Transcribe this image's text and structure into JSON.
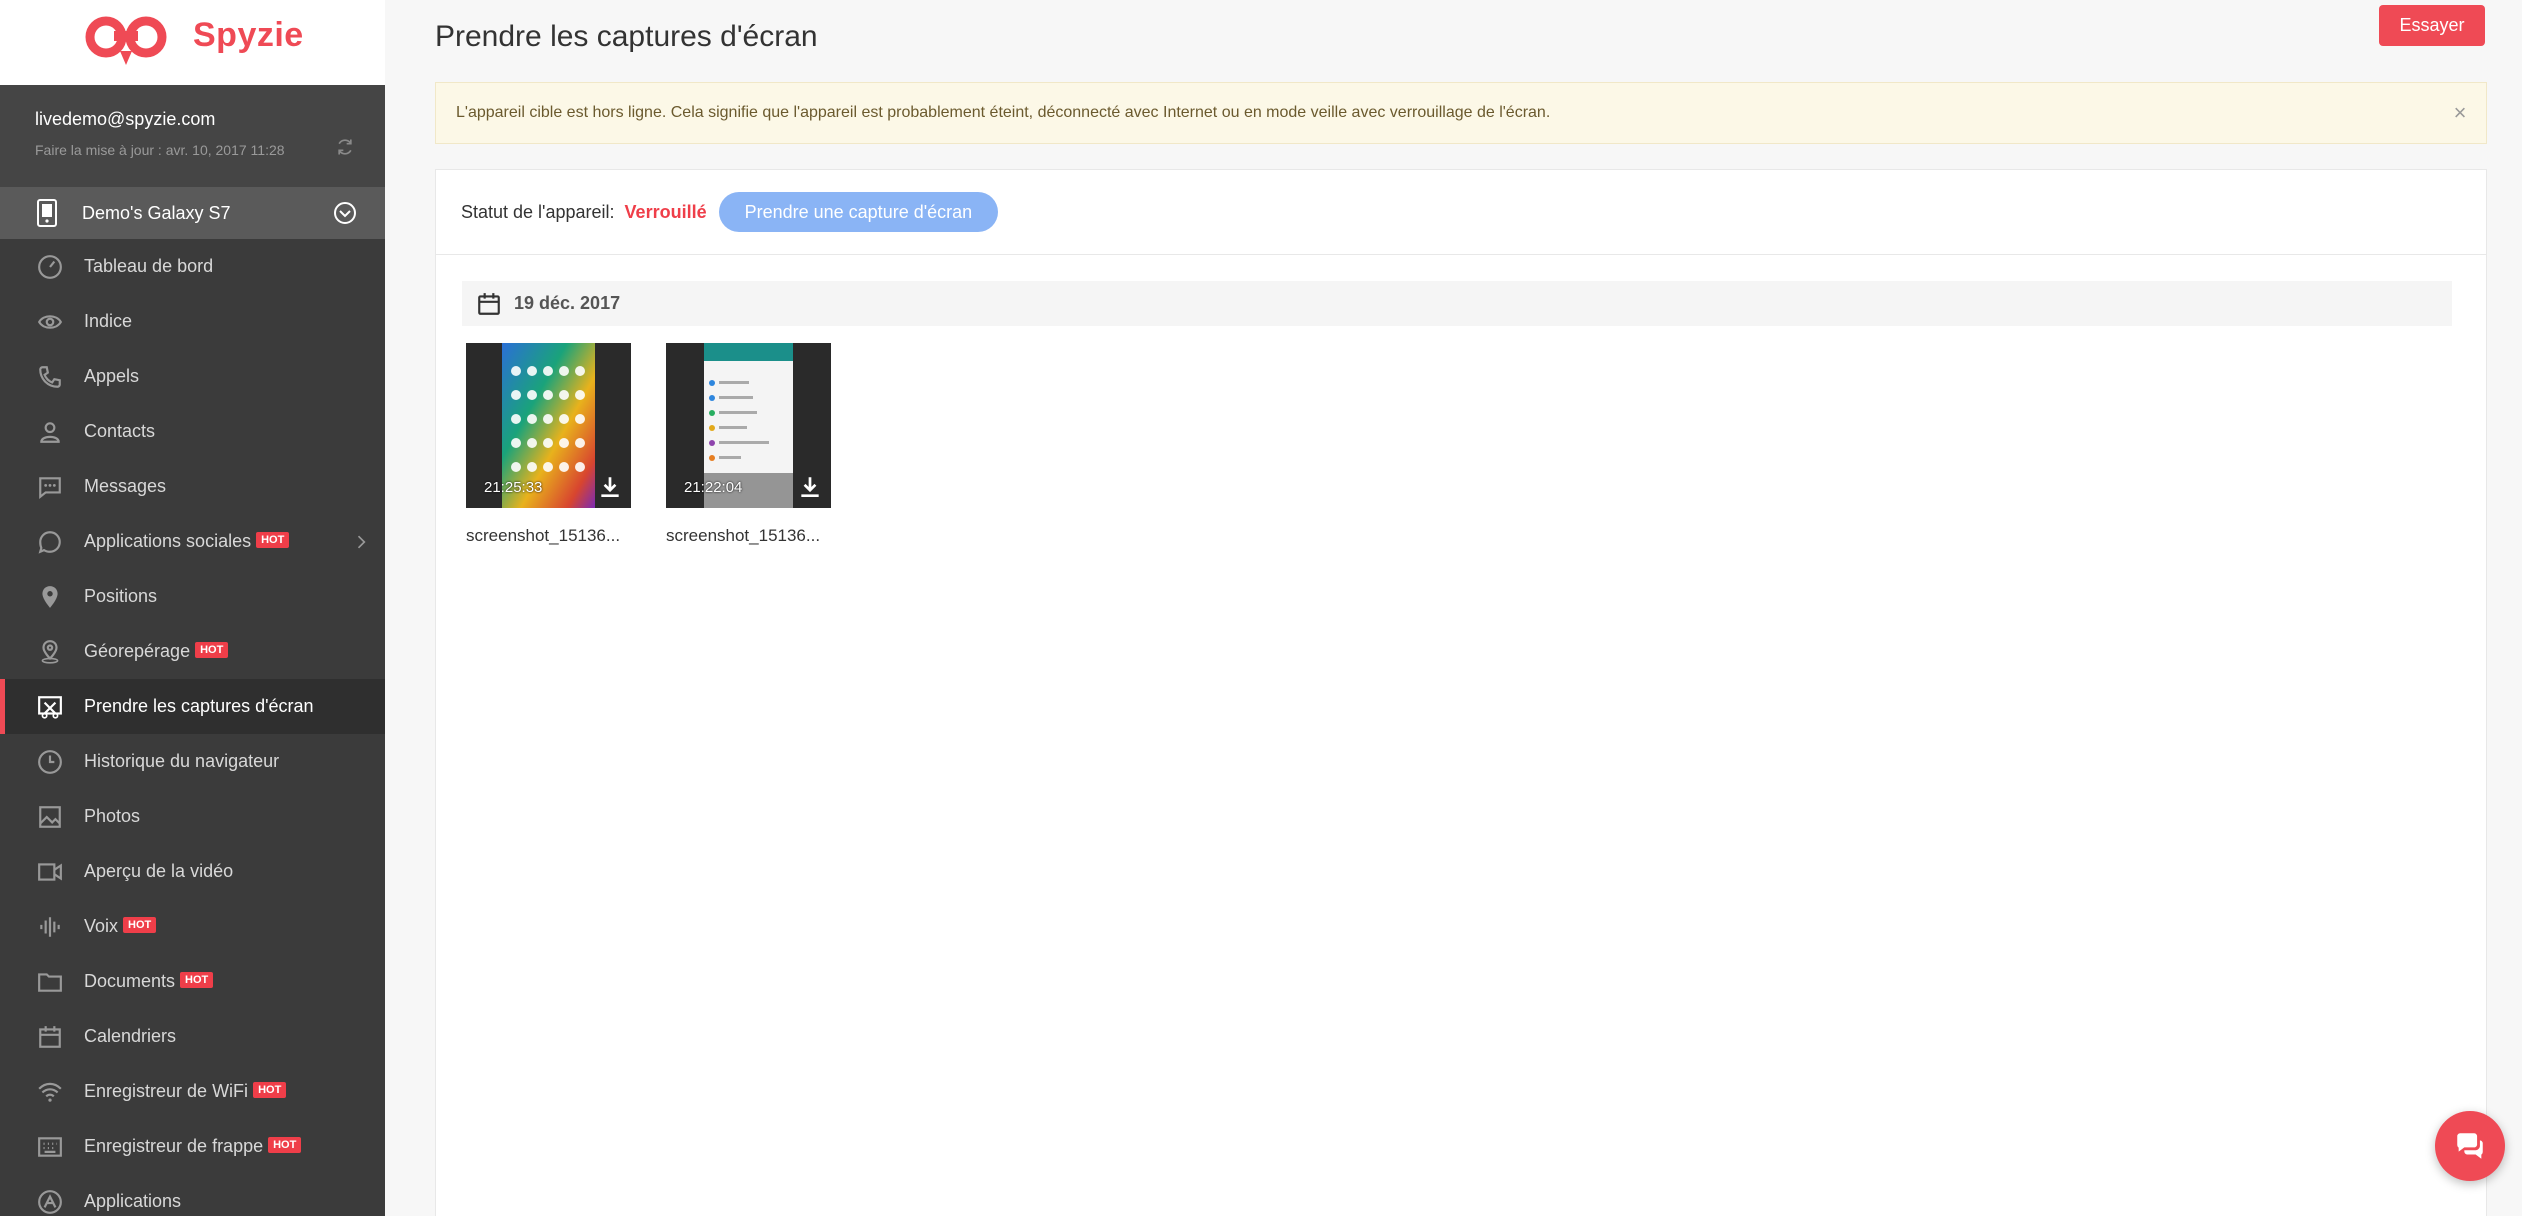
{
  "brand": {
    "name": "Spyzie"
  },
  "account": {
    "email": "livedemo@spyzie.com",
    "update_text": "Faire la mise à jour : avr. 10, 2017 11:28"
  },
  "device": {
    "name": "Demo's Galaxy S7"
  },
  "sidebar": {
    "items": [
      {
        "label": "Tableau de bord",
        "icon": "dashboard-icon",
        "hot": ""
      },
      {
        "label": "Indice",
        "icon": "eye-icon",
        "hot": ""
      },
      {
        "label": "Appels",
        "icon": "phone-icon",
        "hot": ""
      },
      {
        "label": "Contacts",
        "icon": "person-icon",
        "hot": ""
      },
      {
        "label": "Messages",
        "icon": "message-icon",
        "hot": ""
      },
      {
        "label": "Applications sociales",
        "icon": "chat-bubble-icon",
        "hot": "HOT"
      },
      {
        "label": "Positions",
        "icon": "location-pin-icon",
        "hot": ""
      },
      {
        "label": "Géorepérage",
        "icon": "geofence-icon",
        "hot": "HOT"
      },
      {
        "label": "Prendre les captures d'écran",
        "icon": "screenshot-icon",
        "hot": ""
      },
      {
        "label": "Historique du navigateur",
        "icon": "clock-icon",
        "hot": ""
      },
      {
        "label": "Photos",
        "icon": "image-icon",
        "hot": ""
      },
      {
        "label": "Aperçu de la vidéo",
        "icon": "video-icon",
        "hot": ""
      },
      {
        "label": "Voix",
        "icon": "voice-icon",
        "hot": "HOT"
      },
      {
        "label": "Documents",
        "icon": "folder-icon",
        "hot": "HOT"
      },
      {
        "label": "Calendriers",
        "icon": "calendar-icon",
        "hot": ""
      },
      {
        "label": "Enregistreur de WiFi",
        "icon": "wifi-icon",
        "hot": "HOT"
      },
      {
        "label": "Enregistreur de frappe",
        "icon": "keyboard-icon",
        "hot": "HOT"
      },
      {
        "label": "Applications",
        "icon": "apps-icon",
        "hot": ""
      }
    ]
  },
  "header": {
    "title": "Prendre les captures d'écran",
    "try_label": "Essayer"
  },
  "alert": {
    "text": "L'appareil cible est hors ligne. Cela signifie que l'appareil est probablement éteint, déconnecté avec Internet ou en mode veille avec verrouillage de l'écran.",
    "close": "×"
  },
  "status": {
    "label": "Statut de l'appareil:",
    "value": "Verrouillé",
    "capture_label": "Prendre une capture d'écran"
  },
  "gallery": {
    "date": "19 déc. 2017",
    "items": [
      {
        "time": "21:25:33",
        "name": "screenshot_15136..."
      },
      {
        "time": "21:22:04",
        "name": "screenshot_15136..."
      }
    ]
  },
  "colors": {
    "accent": "#ef4a55",
    "sidebar": "#3b3b3b",
    "status_locked": "#ef3e49",
    "capture_button": "#8ab4f5"
  }
}
